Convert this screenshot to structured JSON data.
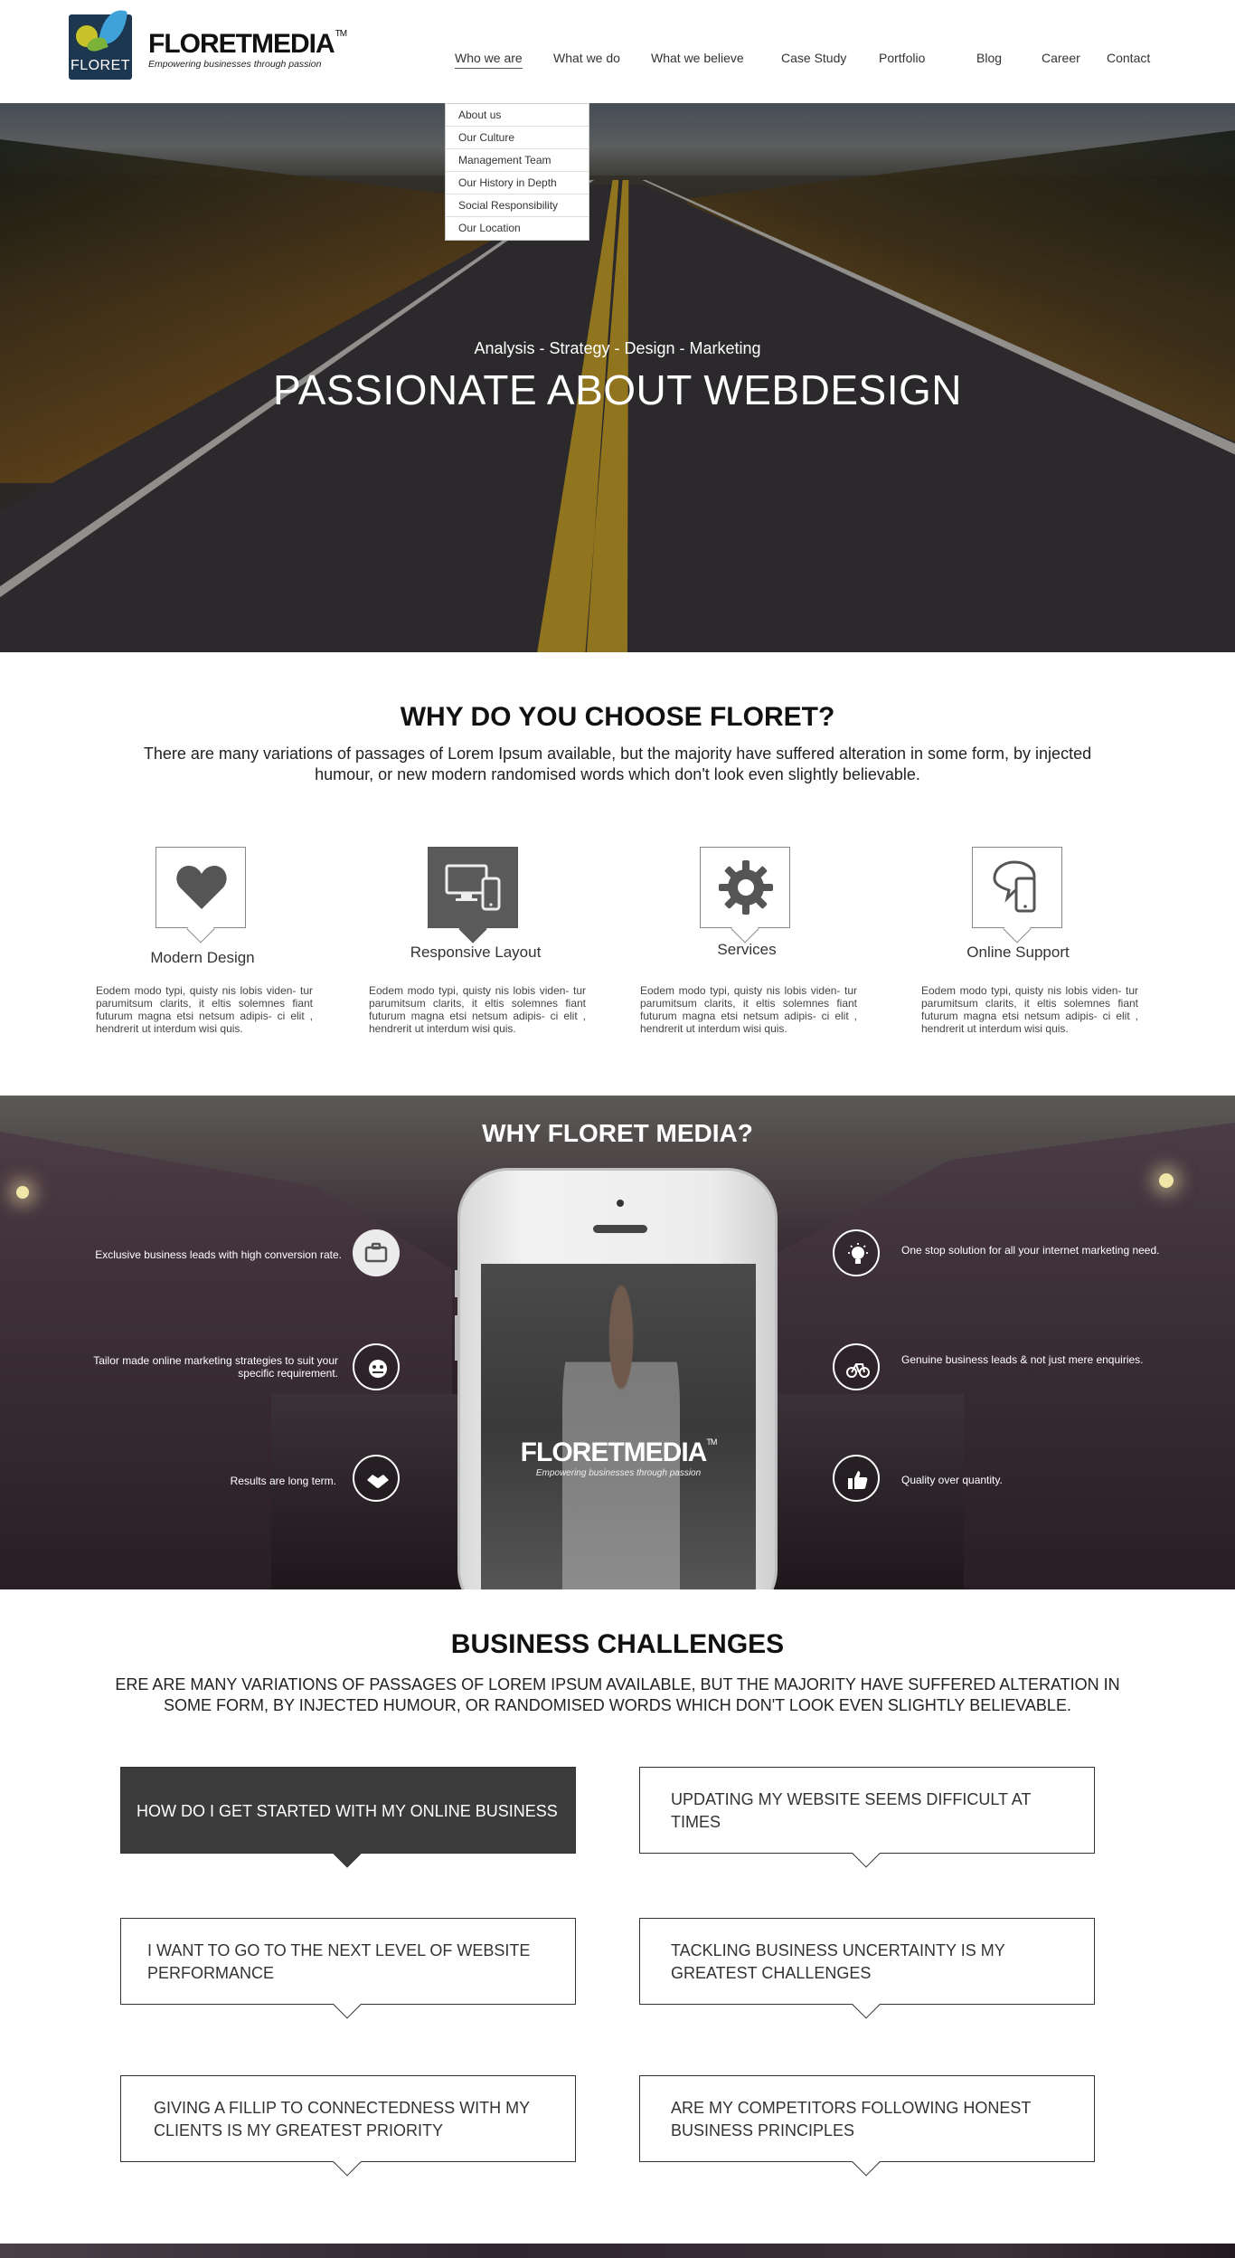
{
  "header": {
    "logo_text": "FLORET",
    "brand": "FLORETMEDIA",
    "trademark": "TM",
    "tagline": "Empowering businesses through passion"
  },
  "nav": {
    "items": [
      {
        "label": "Who we are",
        "active": true
      },
      {
        "label": "What we do"
      },
      {
        "label": "What we believe"
      },
      {
        "label": "Case Study"
      },
      {
        "label": "Portfolio"
      },
      {
        "label": "Blog"
      },
      {
        "label": "Career"
      },
      {
        "label": "Contact"
      }
    ],
    "dropdown": [
      "About us",
      "Our Culture",
      "Management Team",
      "Our History in Depth",
      "Social Responsibility",
      "Our Location"
    ]
  },
  "hero": {
    "subtitle": "Analysis - Strategy - Design - Marketing",
    "title": "PASSIONATE ABOUT WEBDESIGN"
  },
  "why_choose": {
    "title": "WHY DO YOU CHOOSE FLORET?",
    "description": "There are many variations of passages of Lorem Ipsum available, but the majority have suffered alteration in some form, by injected humour, or new modern randomised words which don't look even slightly believable.",
    "features": [
      {
        "name": "Modern Design",
        "icon": "heart-icon",
        "text": "Eodem modo typi, quisty nis lobis viden- tur parumitsum clarits, it eltis solemnes fiant futurum magna etsi netsum adipis- ci elit , hendrerit ut interdum wisi quis."
      },
      {
        "name": "Responsive Layout",
        "icon": "devices-icon",
        "text": "Eodem modo typi, quisty nis lobis viden- tur parumitsum clarits, it eltis solemnes fiant futurum magna etsi netsum adipis- ci elit , hendrerit ut interdum wisi quis."
      },
      {
        "name": "Services",
        "icon": "gear-icon",
        "text": "Eodem modo typi, quisty nis lobis viden- tur parumitsum clarits, it eltis solemnes fiant futurum magna etsi netsum adipis- ci elit , hendrerit ut interdum wisi quis."
      },
      {
        "name": "Online Support",
        "icon": "chat-phone-icon",
        "text": "Eodem modo typi, quisty nis lobis viden- tur parumitsum clarits, it eltis solemnes fiant futurum magna etsi netsum adipis- ci elit , hendrerit ut interdum wisi quis."
      }
    ]
  },
  "why_media": {
    "title": "WHY FLORET MEDIA?",
    "phone_brand": "FLORETMEDIA",
    "phone_trademark": "TM",
    "phone_tagline": "Empowering businesses through passion",
    "left_points": [
      {
        "text": "Exclusive business leads with high conversion rate.",
        "icon": "briefcase-icon"
      },
      {
        "text": "Tailor made online marketing strategies to suit your specific requirement.",
        "icon": "tailor-icon"
      },
      {
        "text": "Results are long term.",
        "icon": "handshake-icon"
      }
    ],
    "right_points": [
      {
        "text": "One stop solution for all your internet marketing need.",
        "icon": "lightbulb-icon"
      },
      {
        "text": "Genuine business leads & not just mere enquiries.",
        "icon": "bicycle-icon"
      },
      {
        "text": "Quality over quantity.",
        "icon": "thumbs-up-icon"
      }
    ]
  },
  "challenges": {
    "title": "BUSINESS CHALLENGES",
    "description": "ERE ARE MANY VARIATIONS OF PASSAGES OF LOREM IPSUM AVAILABLE, BUT THE MAJORITY HAVE SUFFERED ALTERATION IN SOME FORM, BY INJECTED HUMOUR, OR RANDOMISED WORDS WHICH DON'T LOOK EVEN SLIGHTLY BELIEVABLE.",
    "items": [
      "HOW DO I GET STARTED WITH MY ONLINE BUSINESS",
      "UPDATING MY WEBSITE SEEMS DIFFICULT AT TIMES",
      "I WANT TO GO TO THE NEXT LEVEL OF WEBSITE PERFORMANCE",
      "TACKLING BUSINESS UNCERTAINTY IS MY GREATEST CHALLENGES",
      "GIVING A FILLIP TO CONNECTEDNESS WITH MY CLIENTS IS MY GREATEST PRIORITY",
      "ARE MY COMPETITORS FOLLOWING HONEST BUSINESS PRINCIPLES"
    ]
  }
}
